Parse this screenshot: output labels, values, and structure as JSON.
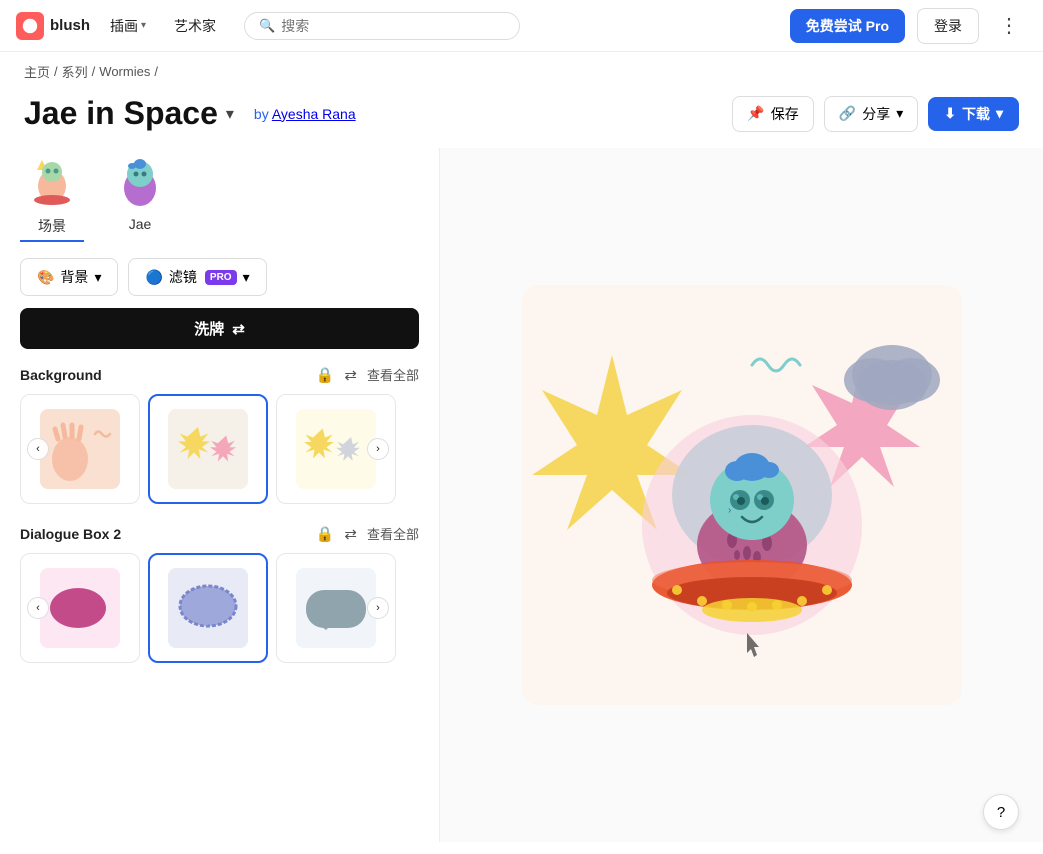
{
  "navbar": {
    "logo_text": "blush",
    "menu_items": [
      {
        "label": "插画",
        "has_chevron": true
      },
      {
        "label": "艺术家",
        "has_chevron": false
      }
    ],
    "search_placeholder": "搜索",
    "btn_pro_label": "免费尝试 Pro",
    "btn_login_label": "登录"
  },
  "breadcrumb": {
    "items": [
      "主页",
      "系列",
      "Wormies",
      ""
    ]
  },
  "header": {
    "title": "Jae in Space",
    "author_prefix": "by",
    "author": "Ayesha Rana",
    "btn_save": "保存",
    "btn_share": "分享",
    "btn_download": "下载"
  },
  "char_tabs": [
    {
      "label": "场景",
      "active": true
    },
    {
      "label": "Jae",
      "active": false
    }
  ],
  "controls": {
    "background_label": "背景",
    "filter_label": "滤镜",
    "pro_badge": "PRO",
    "shuffle_label": "洗牌"
  },
  "sections": [
    {
      "id": "background",
      "title": "Background",
      "view_all": "查看全部",
      "cards": [
        {
          "bg": "#f9e0d0",
          "selected": false,
          "has_left_arrow": true,
          "has_right_arrow": false
        },
        {
          "bg": "#f5f0e8",
          "selected": true,
          "has_left_arrow": false,
          "has_right_arrow": false
        },
        {
          "bg": "#fefce8",
          "selected": false,
          "has_left_arrow": false,
          "has_right_arrow": true
        }
      ]
    },
    {
      "id": "dialogue-box-2",
      "title": "Dialogue Box 2",
      "view_all": "查看全部",
      "cards": [
        {
          "bg": "#c44b8a",
          "selected": false,
          "has_left_arrow": true,
          "has_right_arrow": false
        },
        {
          "bg": "#e8eaf6",
          "selected": true,
          "has_left_arrow": false,
          "has_right_arrow": false
        },
        {
          "bg": "#b0bec5",
          "selected": false,
          "has_left_arrow": false,
          "has_right_arrow": true
        }
      ]
    }
  ],
  "help_btn": "?",
  "colors": {
    "accent_blue": "#2563eb",
    "pro_purple": "#7c3aed"
  }
}
